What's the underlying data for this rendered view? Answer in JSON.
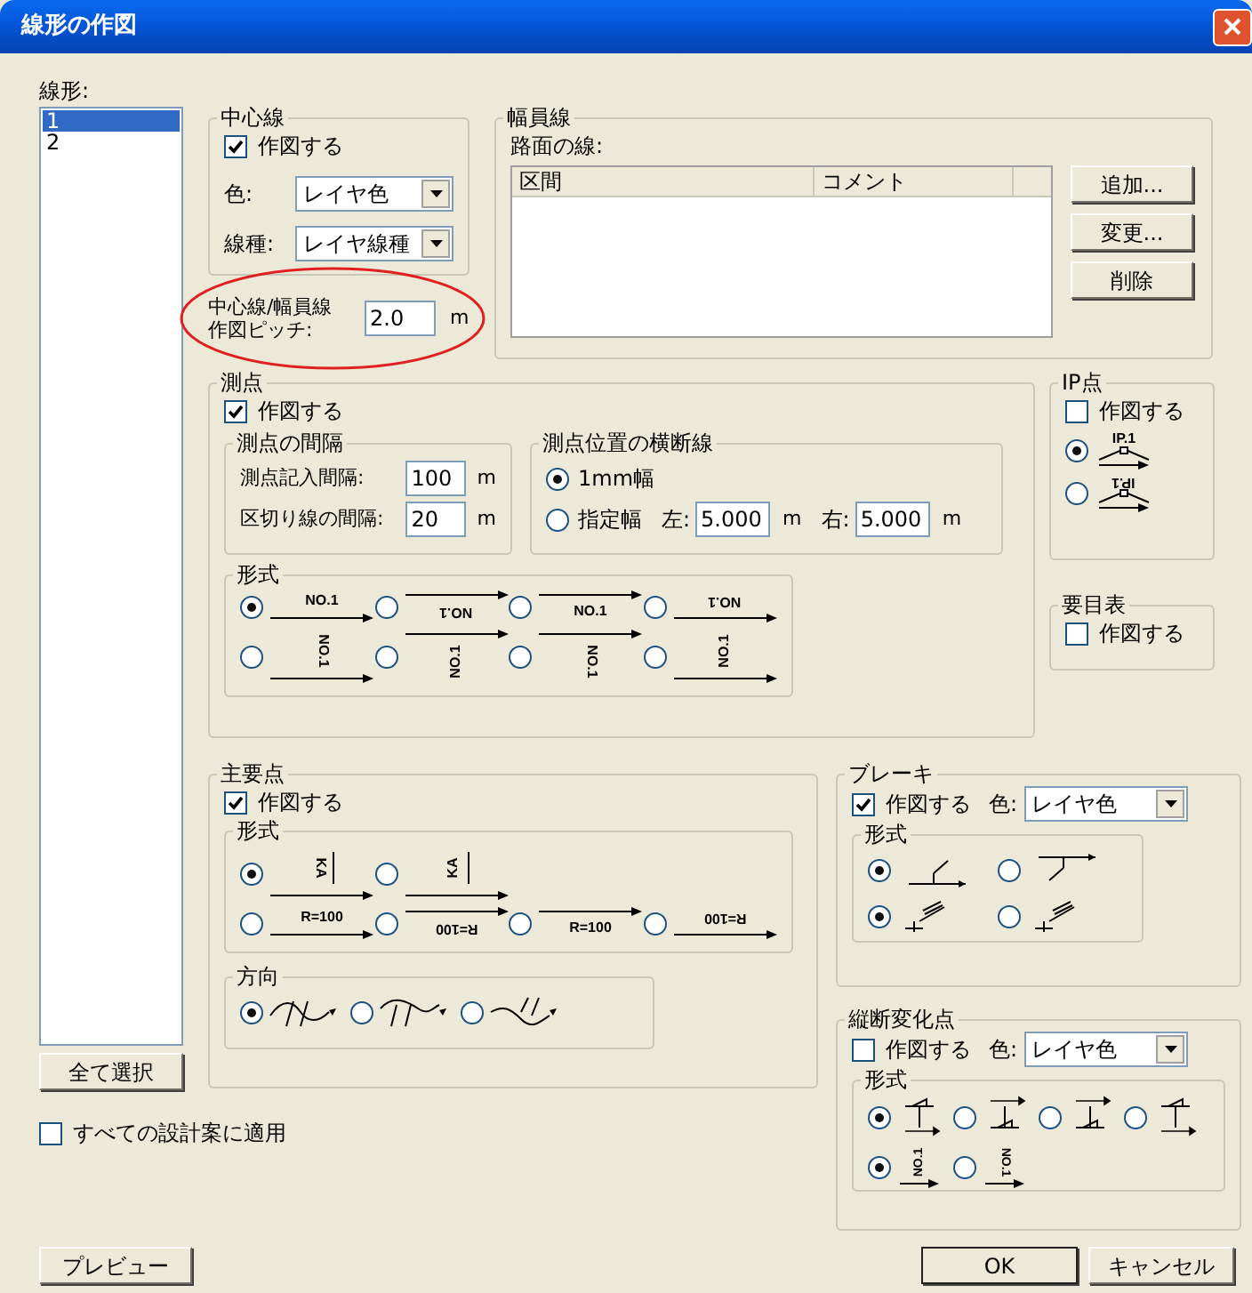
{
  "window": {
    "title": "線形の作図"
  },
  "alignment_list": {
    "label": "線形:",
    "items": [
      {
        "label": "1",
        "selected": true
      },
      {
        "label": "2",
        "selected": false
      }
    ],
    "select_all_button": "全て選択"
  },
  "apply_all": {
    "label": "すべての設計案に適用",
    "checked": false
  },
  "center_line": {
    "title": "中心線",
    "draw": {
      "label": "作図する",
      "checked": true
    },
    "color": {
      "label": "色:",
      "value": "レイヤ色"
    },
    "line_type": {
      "label": "線種:",
      "value": "レイヤ線種"
    }
  },
  "pitch": {
    "label_lines": [
      "中心線/幅員線",
      "作図ピッチ:"
    ],
    "value": "2.0",
    "unit": "m"
  },
  "width_line": {
    "title": "幅員線",
    "label": "路面の線:",
    "columns": [
      "区間",
      "コメント"
    ],
    "buttons": [
      "追加...",
      "変更...",
      "削除"
    ]
  },
  "station": {
    "title": "測点",
    "draw": {
      "label": "作図する",
      "checked": true
    },
    "interval": {
      "title": "測点の間隔",
      "fields": [
        {
          "label": "測点記入間隔:",
          "value": "100",
          "unit": "m"
        },
        {
          "label": "区切り線の間隔:",
          "value": "20",
          "unit": "m"
        }
      ]
    },
    "cross_line": {
      "title": "測点位置の横断線",
      "options": [
        {
          "label": "1mm幅",
          "selected": true
        },
        {
          "label": "指定幅",
          "selected": false
        }
      ],
      "left": {
        "label": "左:",
        "value": "5.000",
        "unit": "m"
      },
      "right": {
        "label": "右:",
        "value": "5.000",
        "unit": "m"
      }
    },
    "format": {
      "title": "形式",
      "rows": [
        {
          "options": [
            {
              "selected": true,
              "kind": "over",
              "sample": "NO.1"
            },
            {
              "selected": false,
              "kind": "flipunder",
              "sample": "NO.1"
            },
            {
              "selected": false,
              "kind": "under",
              "sample": "NO.1"
            },
            {
              "selected": false,
              "kind": "flipover",
              "sample": "NO.1"
            }
          ]
        },
        {
          "options": [
            {
              "selected": false,
              "kind": "cwover",
              "sample": "NO.1"
            },
            {
              "selected": false,
              "kind": "ccwunder",
              "sample": "NO.1"
            },
            {
              "selected": false,
              "kind": "cwunder",
              "sample": "NO.1"
            },
            {
              "selected": false,
              "kind": "ccwover",
              "sample": "NO.1"
            }
          ]
        }
      ]
    }
  },
  "ip_point": {
    "title": "IP点",
    "draw": {
      "label": "作図する",
      "checked": false
    },
    "options": [
      {
        "selected": true,
        "kind": "upright",
        "sample": "IP.1"
      },
      {
        "selected": false,
        "kind": "flipped",
        "sample": "IP.1"
      }
    ]
  },
  "summary_table": {
    "title": "要目表",
    "draw": {
      "label": "作図する",
      "checked": false
    }
  },
  "main_point": {
    "title": "主要点",
    "draw": {
      "label": "作図する",
      "checked": true
    },
    "format": {
      "title": "形式",
      "rows": [
        {
          "options": [
            {
              "selected": true,
              "kind": "tickcw",
              "sample": "KA"
            },
            {
              "selected": false,
              "kind": "tickccw",
              "sample": "KA"
            }
          ]
        },
        {
          "options": [
            {
              "selected": false,
              "kind": "over",
              "sample": "R=100"
            },
            {
              "selected": false,
              "kind": "flipunder",
              "sample": "R=100"
            },
            {
              "selected": false,
              "kind": "under",
              "sample": "R=100"
            },
            {
              "selected": false,
              "kind": "flipover",
              "sample": "R=100"
            }
          ]
        }
      ]
    },
    "direction": {
      "title": "方向",
      "options": [
        {
          "selected": true
        },
        {
          "selected": false
        },
        {
          "selected": false
        }
      ]
    }
  },
  "brake": {
    "title": "ブレーキ",
    "draw": {
      "label": "作図する",
      "checked": true
    },
    "color": {
      "label": "色:",
      "value": "レイヤ色"
    },
    "format": {
      "title": "形式",
      "rows": [
        {
          "options": [
            {
              "selected": true
            },
            {
              "selected": false
            }
          ]
        },
        {
          "options": [
            {
              "selected": true
            },
            {
              "selected": false
            }
          ]
        }
      ]
    }
  },
  "vertical_change": {
    "title": "縦断変化点",
    "draw": {
      "label": "作図する",
      "checked": false
    },
    "color": {
      "label": "色:",
      "value": "レイヤ色"
    },
    "format": {
      "title": "形式",
      "rows": [
        {
          "options": [
            {
              "selected": true
            },
            {
              "selected": false
            },
            {
              "selected": false
            },
            {
              "selected": false
            }
          ]
        },
        {
          "options": [
            {
              "selected": true,
              "kind": "ccw",
              "sample": "NO.1"
            },
            {
              "selected": false,
              "kind": "cw",
              "sample": "NO.1"
            }
          ]
        }
      ]
    }
  },
  "footer": {
    "preview": "プレビュー",
    "ok": "OK",
    "cancel": "キャンセル"
  }
}
